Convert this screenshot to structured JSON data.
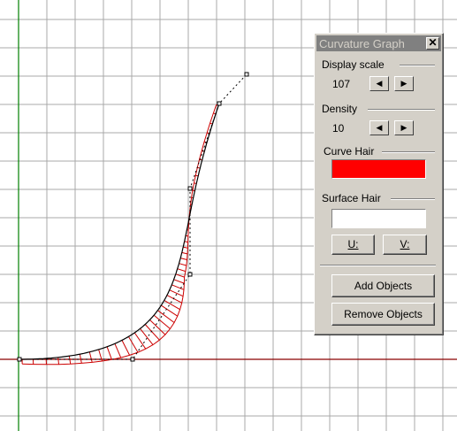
{
  "panel": {
    "title": "Curvature Graph",
    "close_label": "✕",
    "display_scale": {
      "label": "Display scale",
      "value": "107"
    },
    "density": {
      "label": "Density",
      "value": "10"
    },
    "arrows": {
      "left": "◀",
      "right": "▶"
    },
    "curve_hair": {
      "label": "Curve Hair",
      "color": "#ff0000"
    },
    "surface_hair": {
      "label": "Surface Hair",
      "color": "#ffffff"
    },
    "u_button": "U:",
    "v_button": "V:",
    "add_objects": "Add Objects",
    "remove_objects": "Remove Objects"
  },
  "viewport": {
    "grid_color": "#a8a8a8",
    "x_axis_color": "#8b0000",
    "y_axis_color": "#008000",
    "curve_color": "#000000",
    "hair_color": "#cc0000"
  }
}
